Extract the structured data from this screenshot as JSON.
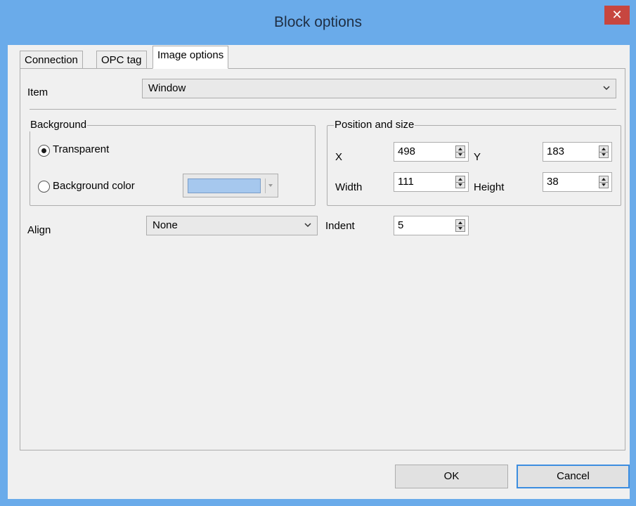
{
  "window": {
    "title": "Block options",
    "close_glyph": "✕"
  },
  "tabs": [
    {
      "label": "Connection",
      "active": false
    },
    {
      "label": "OPC tag",
      "active": false
    },
    {
      "label": "Image options",
      "active": true
    }
  ],
  "item": {
    "label": "Item",
    "value": "Window"
  },
  "background": {
    "group_title": "Background",
    "transparent_label": "Transparent",
    "transparent_selected": true,
    "color_label": "Background color",
    "color_selected": false,
    "color_value": "#a6c8ee"
  },
  "position": {
    "group_title": "Position and size",
    "x_label": "X",
    "x_value": "498",
    "y_label": "Y",
    "y_value": "183",
    "width_label": "Width",
    "width_value": "111",
    "height_label": "Height",
    "height_value": "38"
  },
  "align": {
    "label": "Align",
    "value": "None"
  },
  "indent": {
    "label": "Indent",
    "value": "5"
  },
  "buttons": {
    "ok": "OK",
    "cancel": "Cancel"
  },
  "colors": {
    "titlebar": "#6aabea",
    "close": "#c7463f",
    "accent": "#3c8de0"
  }
}
